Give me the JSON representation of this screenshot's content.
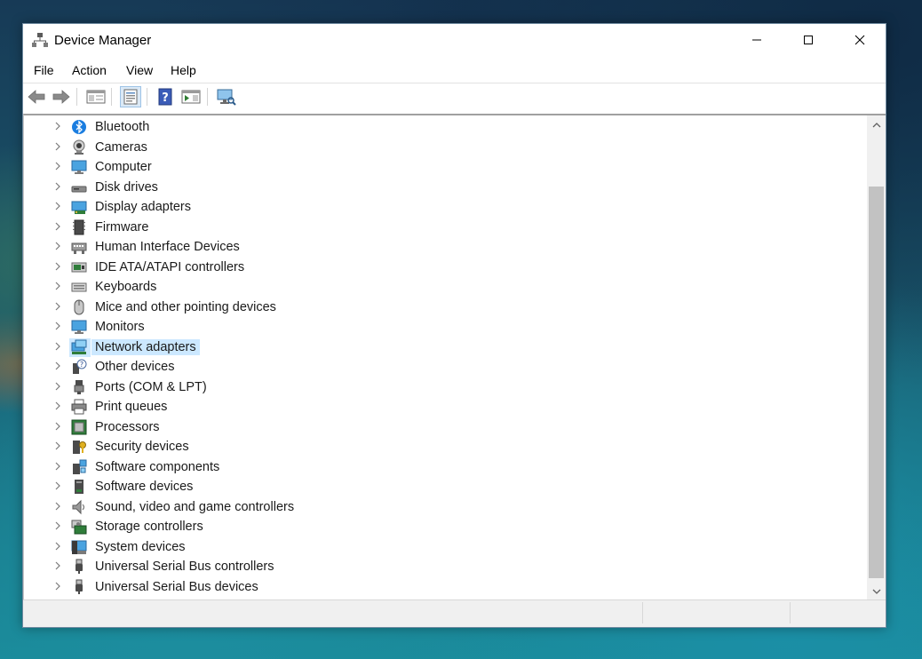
{
  "window": {
    "title": "Device Manager"
  },
  "menu": {
    "items": [
      "File",
      "Action",
      "View",
      "Help"
    ]
  },
  "toolbar": {
    "buttons": [
      {
        "icon": "back-arrow-icon"
      },
      {
        "icon": "forward-arrow-icon"
      },
      {
        "icon": "show-hide-console-tree-icon"
      },
      {
        "icon": "properties-icon"
      },
      {
        "icon": "help-icon"
      },
      {
        "icon": "show-action-pane-icon"
      },
      {
        "icon": "scan-hardware-icon"
      }
    ]
  },
  "tree": {
    "selected_index": 11,
    "items": [
      {
        "label": "Bluetooth",
        "icon": "bluetooth-icon"
      },
      {
        "label": "Cameras",
        "icon": "camera-icon"
      },
      {
        "label": "Computer",
        "icon": "computer-icon"
      },
      {
        "label": "Disk drives",
        "icon": "disk-drive-icon"
      },
      {
        "label": "Display adapters",
        "icon": "display-adapter-icon"
      },
      {
        "label": "Firmware",
        "icon": "firmware-icon"
      },
      {
        "label": "Human Interface Devices",
        "icon": "hid-icon"
      },
      {
        "label": "IDE ATA/ATAPI controllers",
        "icon": "ide-controller-icon"
      },
      {
        "label": "Keyboards",
        "icon": "keyboard-icon"
      },
      {
        "label": "Mice and other pointing devices",
        "icon": "mouse-icon"
      },
      {
        "label": "Monitors",
        "icon": "monitor-icon"
      },
      {
        "label": "Network adapters",
        "icon": "network-adapter-icon"
      },
      {
        "label": "Other devices",
        "icon": "unknown-device-icon"
      },
      {
        "label": "Ports (COM & LPT)",
        "icon": "port-icon"
      },
      {
        "label": "Print queues",
        "icon": "printer-icon"
      },
      {
        "label": "Processors",
        "icon": "processor-icon"
      },
      {
        "label": "Security devices",
        "icon": "security-device-icon"
      },
      {
        "label": "Software components",
        "icon": "software-component-icon"
      },
      {
        "label": "Software devices",
        "icon": "software-device-icon"
      },
      {
        "label": "Sound, video and game controllers",
        "icon": "speaker-icon"
      },
      {
        "label": "Storage controllers",
        "icon": "storage-controller-icon"
      },
      {
        "label": "System devices",
        "icon": "system-device-icon"
      },
      {
        "label": "Universal Serial Bus controllers",
        "icon": "usb-icon"
      },
      {
        "label": "Universal Serial Bus devices",
        "icon": "usb-device-icon"
      }
    ]
  },
  "colors": {
    "selection": "#cce8ff",
    "window_border": "#6f8aa0"
  }
}
